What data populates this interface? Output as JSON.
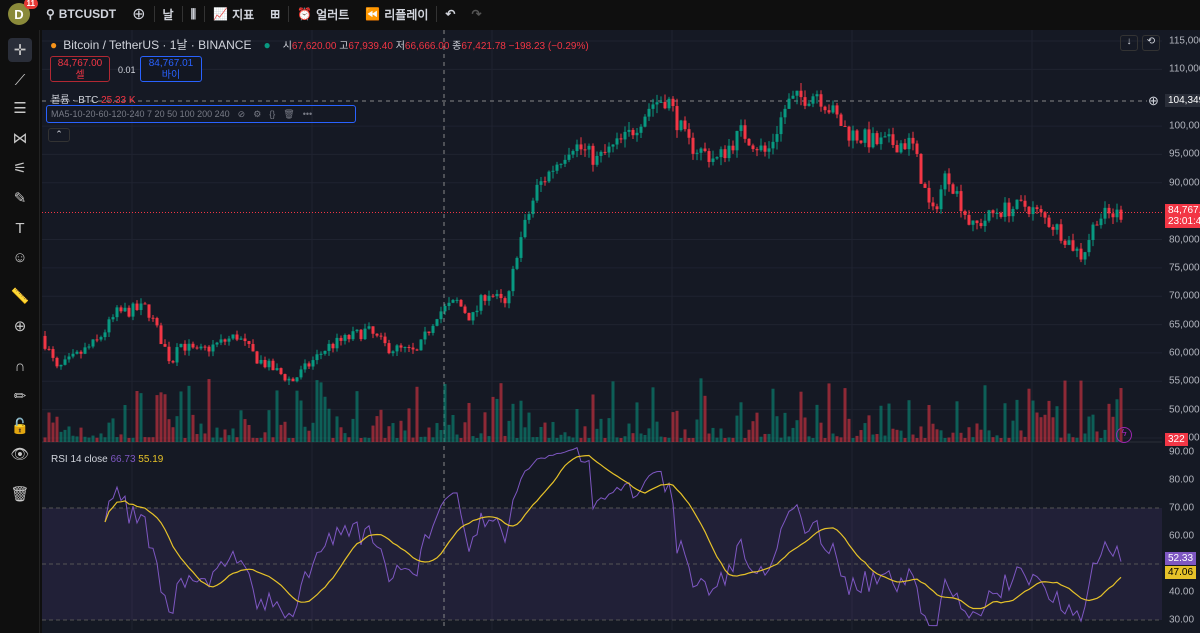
{
  "topbar": {
    "avatar": "D",
    "notifications": "11",
    "symbol": "BTCUSDT",
    "interval": "날",
    "indicators": "지표",
    "alerts": "얼러트",
    "replay": "리플레이"
  },
  "legend": {
    "title": "Bitcoin / TetherUS · 1날 · BINANCE",
    "open_label": "시",
    "open": "67,620.00",
    "high_label": "고",
    "high": "67,939.40",
    "low_label": "저",
    "low": "66,666.00",
    "close_label": "종",
    "close": "67,421.78",
    "change": "−198.23 (−0.29%)"
  },
  "trade": {
    "sell_price": "84,767.00",
    "sell_label": "셀",
    "spread": "0.01",
    "buy_price": "84,767.01",
    "buy_label": "바이"
  },
  "volume": {
    "label": "볼륨 · BTC",
    "value": "25.33 K"
  },
  "ma": {
    "label": "MA5-10-20-60-120-240 7 20 50 100 200 240"
  },
  "rsi": {
    "label": "RSI 14 close",
    "value1": "66.73",
    "value2": "55.19"
  },
  "price_axis": {
    "ticks": [
      "115,000.00",
      "110,000.00",
      "100,000.00",
      "95,000.00",
      "90,000.00",
      "80,000.00",
      "75,000.00",
      "70,000.00",
      "65,000.00",
      "60,000.00",
      "55,000.00",
      "50,000.00",
      "45,000.00"
    ],
    "crosshair_price": "104,349",
    "last_price": "84,767.00",
    "countdown": "23:01:4",
    "volume_tag": "322"
  },
  "rsi_axis": {
    "ticks": [
      "90.00",
      "80.00",
      "70.00",
      "60.00",
      "40.00",
      "30.00"
    ],
    "rsi_tag": "52.33",
    "ma_tag": "47.06"
  },
  "colors": {
    "up": "#089981",
    "down": "#f23645",
    "rsi": "#7e57c2",
    "rsi_ma": "#e6c229"
  },
  "chart_data": {
    "type": "candlestick",
    "ylim": [
      45000,
      115000
    ],
    "path": [
      [
        0,
        63000
      ],
      [
        15,
        57000
      ],
      [
        55,
        62000
      ],
      [
        75,
        67000
      ],
      [
        105,
        68000
      ],
      [
        130,
        58000
      ],
      [
        135,
        62000
      ],
      [
        155,
        60000
      ],
      [
        195,
        63000
      ],
      [
        215,
        59000
      ],
      [
        250,
        55000
      ],
      [
        285,
        61000
      ],
      [
        325,
        64000
      ],
      [
        345,
        61000
      ],
      [
        375,
        60000
      ],
      [
        395,
        67000
      ],
      [
        415,
        69000
      ],
      [
        430,
        66000
      ],
      [
        445,
        71000
      ],
      [
        465,
        68000
      ],
      [
        475,
        78000
      ],
      [
        495,
        89000
      ],
      [
        530,
        97000
      ],
      [
        555,
        94000
      ],
      [
        585,
        98000
      ],
      [
        610,
        104000
      ],
      [
        625,
        105000
      ],
      [
        645,
        97000
      ],
      [
        675,
        94000
      ],
      [
        700,
        99000
      ],
      [
        725,
        95000
      ],
      [
        745,
        104000
      ],
      [
        775,
        106000
      ],
      [
        805,
        99000
      ],
      [
        835,
        97000
      ],
      [
        870,
        97000
      ],
      [
        890,
        84000
      ],
      [
        905,
        92000
      ],
      [
        930,
        82000
      ],
      [
        955,
        85000
      ],
      [
        985,
        86000
      ],
      [
        1015,
        82000
      ],
      [
        1040,
        77000
      ],
      [
        1055,
        84000
      ],
      [
        1080,
        84700
      ]
    ]
  }
}
